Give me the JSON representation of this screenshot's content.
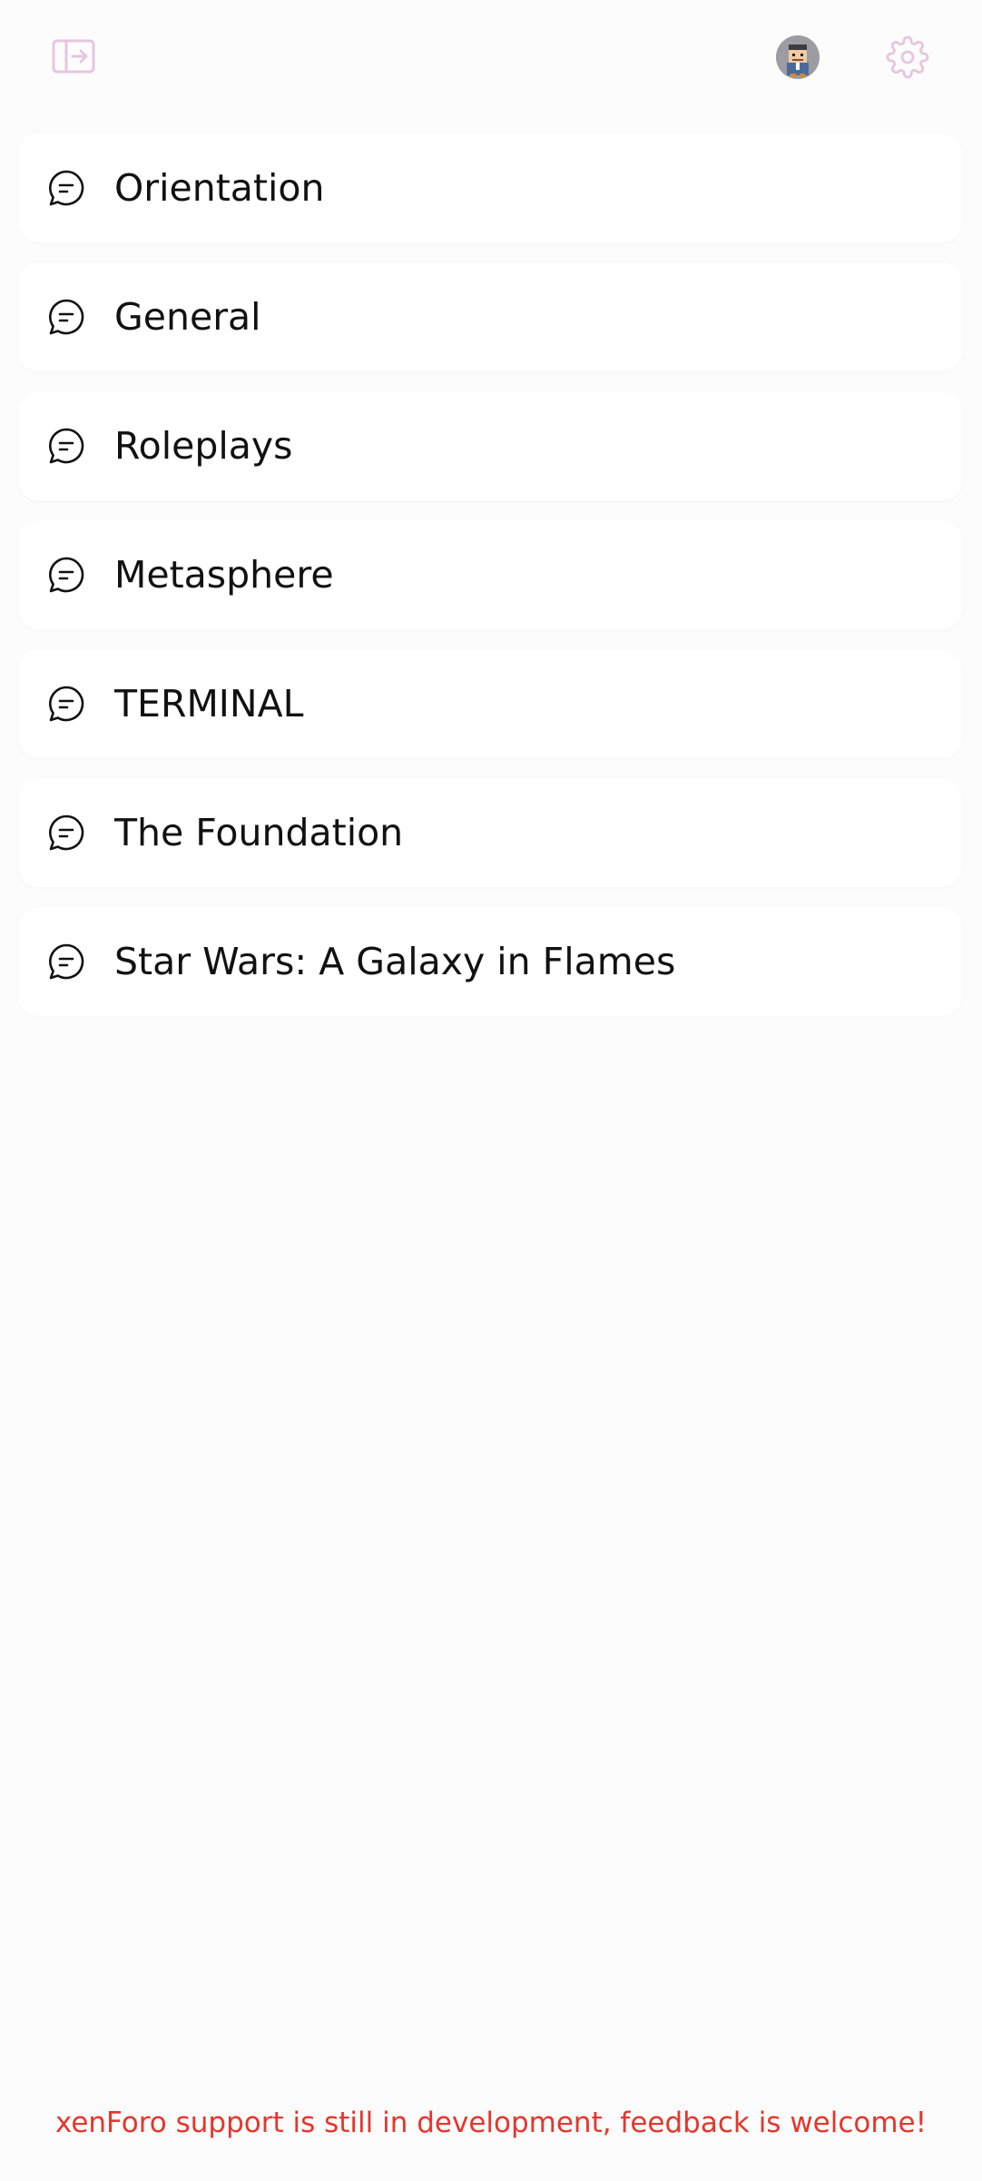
{
  "header": {
    "sidebar_toggle_icon": "sidebar-expand-icon",
    "avatar_icon": "user-avatar",
    "settings_icon": "gear-icon",
    "accent_color": "#e6c6df"
  },
  "forums": [
    {
      "label": "Orientation",
      "icon": "chat-bubble-icon"
    },
    {
      "label": "General",
      "icon": "chat-bubble-icon"
    },
    {
      "label": "Roleplays",
      "icon": "chat-bubble-icon"
    },
    {
      "label": "Metasphere",
      "icon": "chat-bubble-icon"
    },
    {
      "label": "TERMINAL",
      "icon": "chat-bubble-icon"
    },
    {
      "label": "The Foundation",
      "icon": "chat-bubble-icon"
    },
    {
      "label": "Star Wars: A Galaxy in Flames",
      "icon": "chat-bubble-icon"
    }
  ],
  "footer": {
    "notice": "xenForo support is still in development, feedback is welcome!",
    "color": "#e5362c"
  }
}
